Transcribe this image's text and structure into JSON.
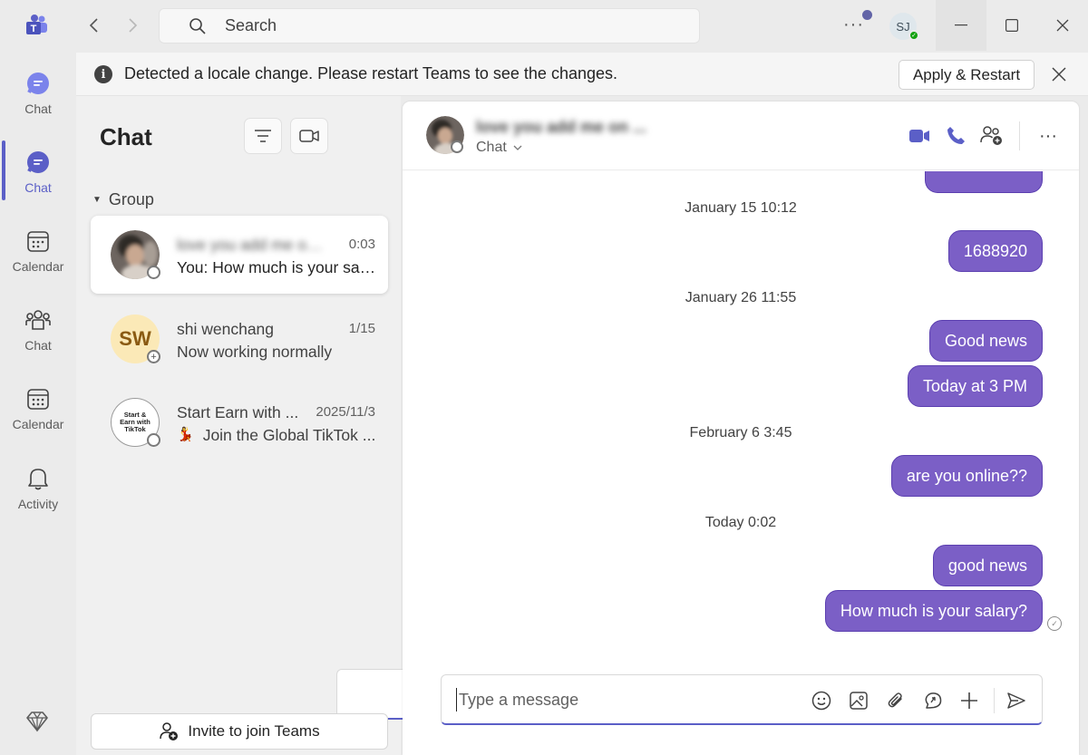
{
  "search": {
    "placeholder": "Search"
  },
  "user": {
    "initials": "SJ"
  },
  "rail": {
    "items": [
      {
        "label": "Chat",
        "icon": "chat-bubble-icon"
      },
      {
        "label": "Chat",
        "icon": "chat-bubble-icon"
      },
      {
        "label": "Calendar",
        "icon": "calendar-icon"
      },
      {
        "label": "Chat",
        "icon": "teams-icon"
      },
      {
        "label": "Calendar",
        "icon": "calendar-icon"
      },
      {
        "label": "Activity",
        "icon": "bell-icon"
      }
    ]
  },
  "banner": {
    "text": "Detected a locale change. Please restart Teams to see the changes.",
    "button": "Apply & Restart"
  },
  "chatlist": {
    "title": "Chat",
    "group_label": "Group",
    "items": [
      {
        "name": "love you add me on ...",
        "time": "0:03",
        "preview": "You: How much is your sala..."
      },
      {
        "name": "shi wenchang",
        "initials": "SW",
        "time": "1/15",
        "preview": "Now working normally"
      },
      {
        "name": "Start Earn with ...",
        "avatar_text": "Start & Earn with TikTok",
        "time": "2025/11/3",
        "preview": "Join the Global TikTok ...",
        "preview_emoji": "💃"
      }
    ],
    "invite_button": "Invite to join Teams"
  },
  "conversation": {
    "name": "love you add me on ...",
    "subtitle": "Chat",
    "messages": [
      {
        "type": "timestamp",
        "text": "January 15 10:12"
      },
      {
        "type": "bubble",
        "text": "1688920"
      },
      {
        "type": "timestamp",
        "text": "January 26 11:55"
      },
      {
        "type": "bubble",
        "text": "Good news"
      },
      {
        "type": "bubble",
        "text": "Today at 3 PM"
      },
      {
        "type": "timestamp",
        "text": "February 6 3:45"
      },
      {
        "type": "bubble",
        "text": "are you online??"
      },
      {
        "type": "timestamp",
        "text": "Today 0:02"
      },
      {
        "type": "bubble",
        "text": "good news"
      },
      {
        "type": "bubble",
        "text": "How much is your salary?"
      }
    ],
    "compose_placeholder": "Type a message"
  },
  "colors": {
    "accent": "#5b5fc7",
    "bubble": "#7b5fc6"
  }
}
